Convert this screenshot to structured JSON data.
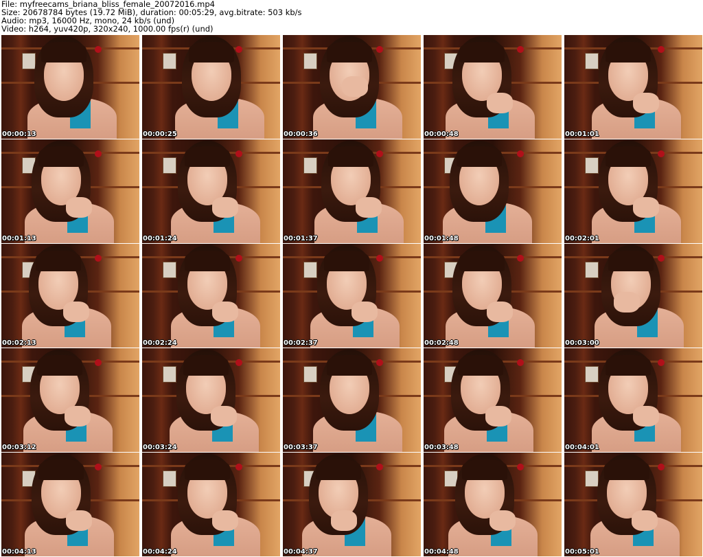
{
  "header": {
    "file_line": "File: myfreecams_briana_bliss_female_20072016.mp4",
    "size_line": "Size: 20678784 bytes (19.72 MiB), duration: 00:05:29, avg.bitrate: 503 kb/s",
    "audio_line": "Audio: mp3, 16000 Hz, mono, 24 kb/s (und)",
    "video_line": "Video: h264, yuv420p, 320x240, 1000.00 fps(r) (und)"
  },
  "thumbnails": [
    {
      "timestamp": "00:00:13",
      "pose": "leaning"
    },
    {
      "timestamp": "00:00:25",
      "pose": "leaning"
    },
    {
      "timestamp": "00:00:36",
      "pose": "hand-mouth"
    },
    {
      "timestamp": "00:00:48",
      "pose": "chin-rest"
    },
    {
      "timestamp": "00:01:01",
      "pose": "chin-rest"
    },
    {
      "timestamp": "00:01:13",
      "pose": "chin-rest"
    },
    {
      "timestamp": "00:01:24",
      "pose": "chin-rest"
    },
    {
      "timestamp": "00:01:37",
      "pose": "chin-rest"
    },
    {
      "timestamp": "00:01:48",
      "pose": "head-tilt"
    },
    {
      "timestamp": "00:02:01",
      "pose": "chin-rest"
    },
    {
      "timestamp": "00:02:13",
      "pose": "chin-rest"
    },
    {
      "timestamp": "00:02:24",
      "pose": "chin-rest"
    },
    {
      "timestamp": "00:02:37",
      "pose": "chin-rest"
    },
    {
      "timestamp": "00:02:48",
      "pose": "chin-rest"
    },
    {
      "timestamp": "00:03:00",
      "pose": "hand-cheek"
    },
    {
      "timestamp": "00:03:12",
      "pose": "chin-rest"
    },
    {
      "timestamp": "00:03:24",
      "pose": "chin-rest"
    },
    {
      "timestamp": "00:03:37",
      "pose": "head-tilt"
    },
    {
      "timestamp": "00:03:48",
      "pose": "chin-rest"
    },
    {
      "timestamp": "00:04:01",
      "pose": "chin-rest"
    },
    {
      "timestamp": "00:04:13",
      "pose": "chin-rest"
    },
    {
      "timestamp": "00:04:24",
      "pose": "chin-rest"
    },
    {
      "timestamp": "00:04:37",
      "pose": "hand-chin"
    },
    {
      "timestamp": "00:04:48",
      "pose": "chin-rest"
    },
    {
      "timestamp": "00:05:01",
      "pose": "chin-rest"
    }
  ],
  "colors": {
    "background": "#ffffff",
    "header_text": "#000000",
    "timestamp_text": "#ffffff",
    "timestamp_outline": "#000000",
    "top_accent": "#1a93b5",
    "flower": "#b0101a"
  }
}
